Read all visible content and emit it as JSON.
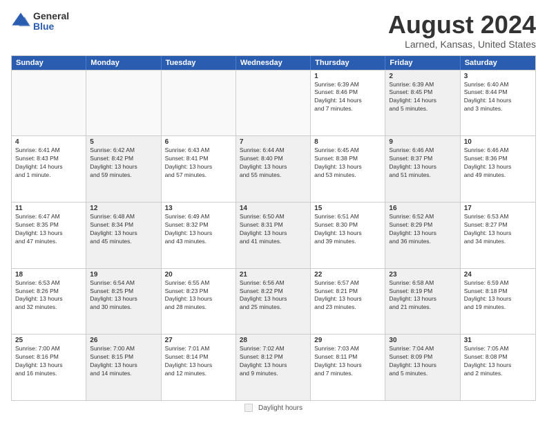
{
  "logo": {
    "general": "General",
    "blue": "Blue"
  },
  "title": "August 2024",
  "subtitle": "Larned, Kansas, United States",
  "days_of_week": [
    "Sunday",
    "Monday",
    "Tuesday",
    "Wednesday",
    "Thursday",
    "Friday",
    "Saturday"
  ],
  "legend_label": "Daylight hours",
  "weeks": [
    [
      {
        "day": "",
        "info": "",
        "empty": true
      },
      {
        "day": "",
        "info": "",
        "empty": true
      },
      {
        "day": "",
        "info": "",
        "empty": true
      },
      {
        "day": "",
        "info": "",
        "empty": true
      },
      {
        "day": "1",
        "info": "Sunrise: 6:39 AM\nSunset: 8:46 PM\nDaylight: 14 hours\nand 7 minutes.",
        "shaded": false
      },
      {
        "day": "2",
        "info": "Sunrise: 6:39 AM\nSunset: 8:45 PM\nDaylight: 14 hours\nand 5 minutes.",
        "shaded": true
      },
      {
        "day": "3",
        "info": "Sunrise: 6:40 AM\nSunset: 8:44 PM\nDaylight: 14 hours\nand 3 minutes.",
        "shaded": false
      }
    ],
    [
      {
        "day": "4",
        "info": "Sunrise: 6:41 AM\nSunset: 8:43 PM\nDaylight: 14 hours\nand 1 minute.",
        "shaded": false
      },
      {
        "day": "5",
        "info": "Sunrise: 6:42 AM\nSunset: 8:42 PM\nDaylight: 13 hours\nand 59 minutes.",
        "shaded": true
      },
      {
        "day": "6",
        "info": "Sunrise: 6:43 AM\nSunset: 8:41 PM\nDaylight: 13 hours\nand 57 minutes.",
        "shaded": false
      },
      {
        "day": "7",
        "info": "Sunrise: 6:44 AM\nSunset: 8:40 PM\nDaylight: 13 hours\nand 55 minutes.",
        "shaded": true
      },
      {
        "day": "8",
        "info": "Sunrise: 6:45 AM\nSunset: 8:38 PM\nDaylight: 13 hours\nand 53 minutes.",
        "shaded": false
      },
      {
        "day": "9",
        "info": "Sunrise: 6:46 AM\nSunset: 8:37 PM\nDaylight: 13 hours\nand 51 minutes.",
        "shaded": true
      },
      {
        "day": "10",
        "info": "Sunrise: 6:46 AM\nSunset: 8:36 PM\nDaylight: 13 hours\nand 49 minutes.",
        "shaded": false
      }
    ],
    [
      {
        "day": "11",
        "info": "Sunrise: 6:47 AM\nSunset: 8:35 PM\nDaylight: 13 hours\nand 47 minutes.",
        "shaded": false
      },
      {
        "day": "12",
        "info": "Sunrise: 6:48 AM\nSunset: 8:34 PM\nDaylight: 13 hours\nand 45 minutes.",
        "shaded": true
      },
      {
        "day": "13",
        "info": "Sunrise: 6:49 AM\nSunset: 8:32 PM\nDaylight: 13 hours\nand 43 minutes.",
        "shaded": false
      },
      {
        "day": "14",
        "info": "Sunrise: 6:50 AM\nSunset: 8:31 PM\nDaylight: 13 hours\nand 41 minutes.",
        "shaded": true
      },
      {
        "day": "15",
        "info": "Sunrise: 6:51 AM\nSunset: 8:30 PM\nDaylight: 13 hours\nand 39 minutes.",
        "shaded": false
      },
      {
        "day": "16",
        "info": "Sunrise: 6:52 AM\nSunset: 8:29 PM\nDaylight: 13 hours\nand 36 minutes.",
        "shaded": true
      },
      {
        "day": "17",
        "info": "Sunrise: 6:53 AM\nSunset: 8:27 PM\nDaylight: 13 hours\nand 34 minutes.",
        "shaded": false
      }
    ],
    [
      {
        "day": "18",
        "info": "Sunrise: 6:53 AM\nSunset: 8:26 PM\nDaylight: 13 hours\nand 32 minutes.",
        "shaded": false
      },
      {
        "day": "19",
        "info": "Sunrise: 6:54 AM\nSunset: 8:25 PM\nDaylight: 13 hours\nand 30 minutes.",
        "shaded": true
      },
      {
        "day": "20",
        "info": "Sunrise: 6:55 AM\nSunset: 8:23 PM\nDaylight: 13 hours\nand 28 minutes.",
        "shaded": false
      },
      {
        "day": "21",
        "info": "Sunrise: 6:56 AM\nSunset: 8:22 PM\nDaylight: 13 hours\nand 25 minutes.",
        "shaded": true
      },
      {
        "day": "22",
        "info": "Sunrise: 6:57 AM\nSunset: 8:21 PM\nDaylight: 13 hours\nand 23 minutes.",
        "shaded": false
      },
      {
        "day": "23",
        "info": "Sunrise: 6:58 AM\nSunset: 8:19 PM\nDaylight: 13 hours\nand 21 minutes.",
        "shaded": true
      },
      {
        "day": "24",
        "info": "Sunrise: 6:59 AM\nSunset: 8:18 PM\nDaylight: 13 hours\nand 19 minutes.",
        "shaded": false
      }
    ],
    [
      {
        "day": "25",
        "info": "Sunrise: 7:00 AM\nSunset: 8:16 PM\nDaylight: 13 hours\nand 16 minutes.",
        "shaded": false
      },
      {
        "day": "26",
        "info": "Sunrise: 7:00 AM\nSunset: 8:15 PM\nDaylight: 13 hours\nand 14 minutes.",
        "shaded": true
      },
      {
        "day": "27",
        "info": "Sunrise: 7:01 AM\nSunset: 8:14 PM\nDaylight: 13 hours\nand 12 minutes.",
        "shaded": false
      },
      {
        "day": "28",
        "info": "Sunrise: 7:02 AM\nSunset: 8:12 PM\nDaylight: 13 hours\nand 9 minutes.",
        "shaded": true
      },
      {
        "day": "29",
        "info": "Sunrise: 7:03 AM\nSunset: 8:11 PM\nDaylight: 13 hours\nand 7 minutes.",
        "shaded": false
      },
      {
        "day": "30",
        "info": "Sunrise: 7:04 AM\nSunset: 8:09 PM\nDaylight: 13 hours\nand 5 minutes.",
        "shaded": true
      },
      {
        "day": "31",
        "info": "Sunrise: 7:05 AM\nSunset: 8:08 PM\nDaylight: 13 hours\nand 2 minutes.",
        "shaded": false
      }
    ]
  ]
}
